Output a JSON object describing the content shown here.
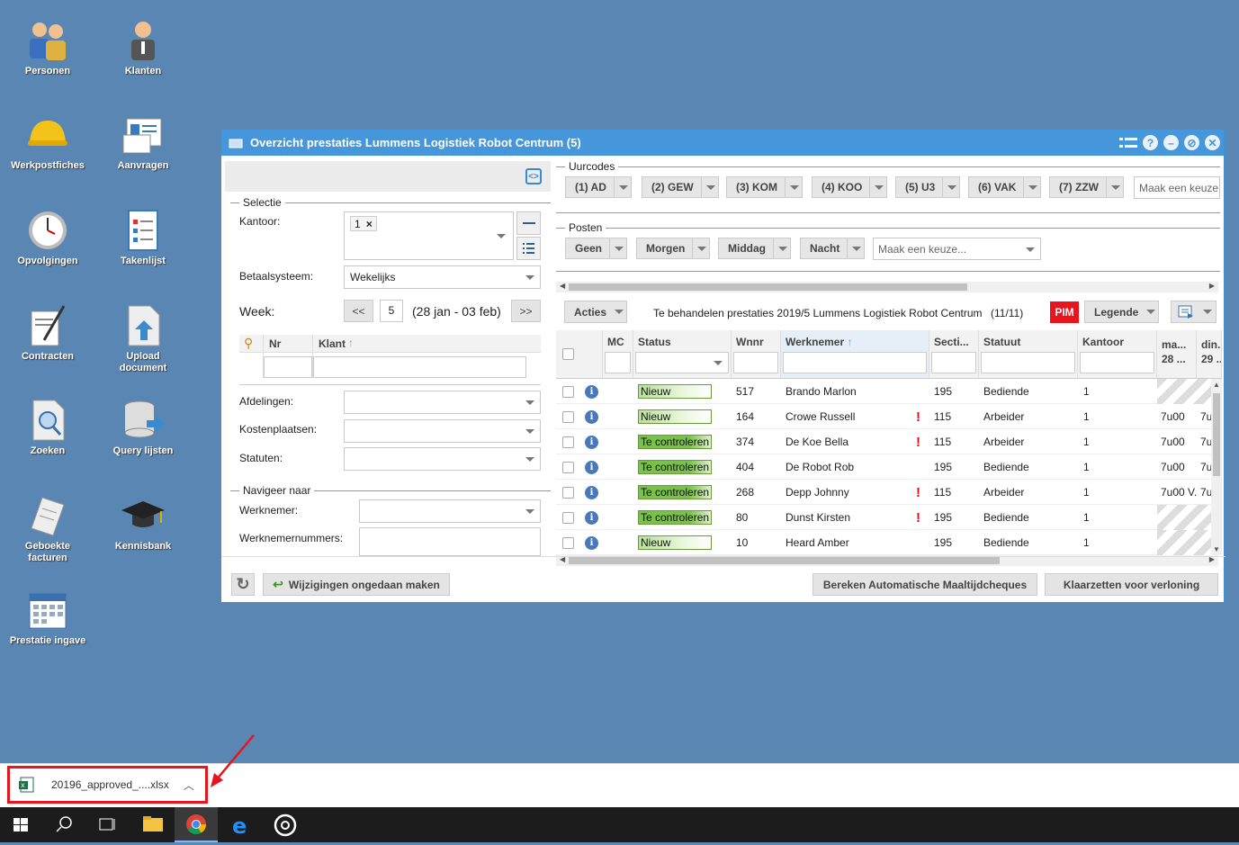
{
  "desktop": {
    "icons": [
      {
        "label": "Personen"
      },
      {
        "label": "Klanten"
      },
      {
        "label": "Werkpostfiches"
      },
      {
        "label": "Aanvragen"
      },
      {
        "label": "Opvolgingen"
      },
      {
        "label": "Takenlijst"
      },
      {
        "label": "Contracten"
      },
      {
        "label": "Upload document"
      },
      {
        "label": "Zoeken"
      },
      {
        "label": "Query lijsten"
      },
      {
        "label": "Geboekte facturen"
      },
      {
        "label": "Kennisbank"
      },
      {
        "label": "Prestatie ingave"
      }
    ]
  },
  "window": {
    "title": "Overzicht prestaties Lummens Logistiek Robot Centrum (5)"
  },
  "left": {
    "selectie_legend": "Selectie",
    "kantoor_label": "Kantoor:",
    "kantoor_tag": "1",
    "betaal_label": "Betaalsysteem:",
    "betaal_value": "Wekelijks",
    "week_label": "Week:",
    "week_prev": "<<",
    "week_value": "5",
    "week_range": "(28 jan - 03 feb)",
    "week_next": ">>",
    "col_nr": "Nr",
    "col_klant": "Klant",
    "afdelingen_label": "Afdelingen:",
    "kosten_label": "Kostenplaatsen:",
    "statuten_label": "Statuten:",
    "navigeer_legend": "Navigeer naar",
    "werknemer_label": "Werknemer:",
    "werknemernummers_label": "Werknemernummers:"
  },
  "uurcodes": {
    "legend": "Uurcodes",
    "items": [
      "(1) AD",
      "(2) GEW",
      "(3) KOM",
      "(4) KOO",
      "(5) U3",
      "(6) VAK",
      "(7) ZZW"
    ],
    "placeholder": "Maak een keuze..."
  },
  "posten": {
    "legend": "Posten",
    "items": [
      "Geen",
      "Morgen",
      "Middag",
      "Nacht"
    ],
    "placeholder": "Maak een keuze..."
  },
  "toolbar": {
    "acties": "Acties",
    "info": "Te behandelen prestaties 2019/5 Lummens Logistiek Robot Centrum",
    "count": "(11/11)",
    "pim": "PIM",
    "legende": "Legende"
  },
  "grid": {
    "headers": {
      "mc": "MC",
      "status": "Status",
      "wnnr": "Wnnr",
      "werknemer": "Werknemer",
      "sectie": "Secti...",
      "statuut": "Statuut",
      "kantoor": "Kantoor",
      "ma": "ma...",
      "ma_sub": "28 ...",
      "di": "din...",
      "di_sub": "29 ..."
    },
    "rows": [
      {
        "status": "Nieuw",
        "st": "n",
        "wnnr": "517",
        "name": "Brando Marlon",
        "excl": "",
        "sectie": "195",
        "statuut": "Bediende",
        "kantoor": "1",
        "ma": "",
        "di": "",
        "hatch": true
      },
      {
        "status": "Nieuw",
        "st": "n",
        "wnnr": "164",
        "name": "Crowe Russell",
        "excl": "!",
        "sectie": "115",
        "statuut": "Arbeider",
        "kantoor": "1",
        "ma": "7u00",
        "di": "7u",
        "hatch": false
      },
      {
        "status": "Te controleren",
        "st": "c",
        "wnnr": "374",
        "name": "De Koe Bella",
        "excl": "!",
        "sectie": "115",
        "statuut": "Arbeider",
        "kantoor": "1",
        "ma": "7u00",
        "di": "7u",
        "hatch": false
      },
      {
        "status": "Te controleren",
        "st": "c",
        "wnnr": "404",
        "name": "De Robot Rob",
        "excl": "",
        "sectie": "195",
        "statuut": "Bediende",
        "kantoor": "1",
        "ma": "7u00",
        "di": "7u",
        "hatch": false
      },
      {
        "status": "Te controleren",
        "st": "c",
        "wnnr": "268",
        "name": "Depp Johnny",
        "excl": "!",
        "sectie": "115",
        "statuut": "Arbeider",
        "kantoor": "1",
        "ma": "7u00 V.",
        "di": "7u",
        "hatch": false
      },
      {
        "status": "Te controleren",
        "st": "c",
        "wnnr": "80",
        "name": "Dunst Kirsten",
        "excl": "!",
        "sectie": "195",
        "statuut": "Bediende",
        "kantoor": "1",
        "ma": "",
        "di": "",
        "hatch": true
      },
      {
        "status": "Nieuw",
        "st": "n",
        "wnnr": "10",
        "name": "Heard Amber",
        "excl": "",
        "sectie": "195",
        "statuut": "Bediende",
        "kantoor": "1",
        "ma": "",
        "di": "",
        "hatch": true
      }
    ]
  },
  "footer": {
    "undo": "Wijzigingen ongedaan maken",
    "bereken": "Bereken Automatische Maaltijdcheques",
    "klaar": "Klaarzetten voor verloning"
  },
  "download": {
    "filename": "20196_approved_....xlsx"
  },
  "colors": {
    "desktop": "#5a86b3",
    "titlebar": "#4596da",
    "pim": "#e8141e"
  }
}
